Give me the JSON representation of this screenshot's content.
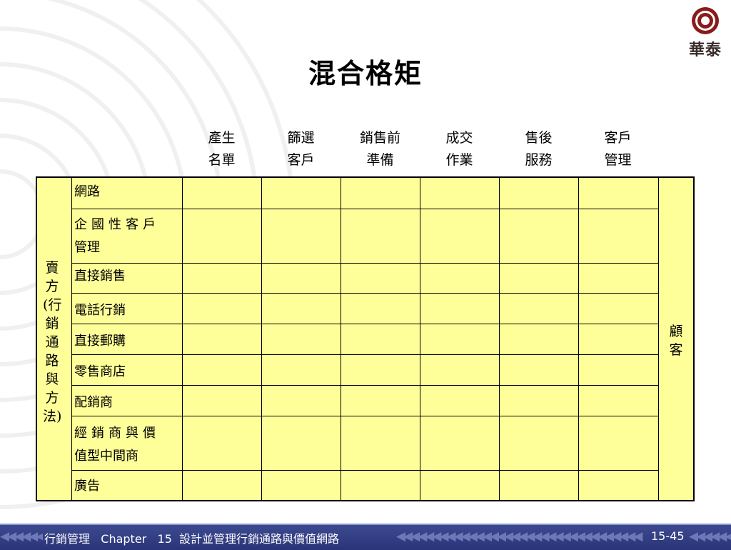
{
  "slide": {
    "title": "混合格矩",
    "logo_text": "華泰"
  },
  "columns": [
    {
      "line1": "產生",
      "line2": "名單"
    },
    {
      "line1": "篩選",
      "line2": "客戶"
    },
    {
      "line1": "銷售前",
      "line2": "準備"
    },
    {
      "line1": "成交",
      "line2": "作業"
    },
    {
      "line1": "售後",
      "line2": "服務"
    },
    {
      "line1": "客戶",
      "line2": "管理"
    }
  ],
  "rows": [
    {
      "line1": "網路",
      "line2": ""
    },
    {
      "line1": "企國性客戶",
      "line2": "管理"
    },
    {
      "line1": "直接銷售",
      "line2": ""
    },
    {
      "line1": "電話行銷",
      "line2": ""
    },
    {
      "line1": "直接郵購",
      "line2": ""
    },
    {
      "line1": "零售商店",
      "line2": ""
    },
    {
      "line1": "配銷商",
      "line2": ""
    },
    {
      "line1": "經銷商與價",
      "line2": "值型中間商"
    },
    {
      "line1": "廣告",
      "line2": ""
    }
  ],
  "seller_label": "賣方(行銷通路與方法)",
  "customer_label": "顧客",
  "footer": {
    "course": "行銷管理",
    "chapter_label": "Chapter",
    "chapter_num": "15",
    "chapter_title": "設計並管理行銷通路與價值網路",
    "page": "15-45"
  },
  "colors": {
    "cell_fill": "#ffff99",
    "footer_bg": "#2f3a80",
    "logo_ring": "#8b1a1a"
  }
}
